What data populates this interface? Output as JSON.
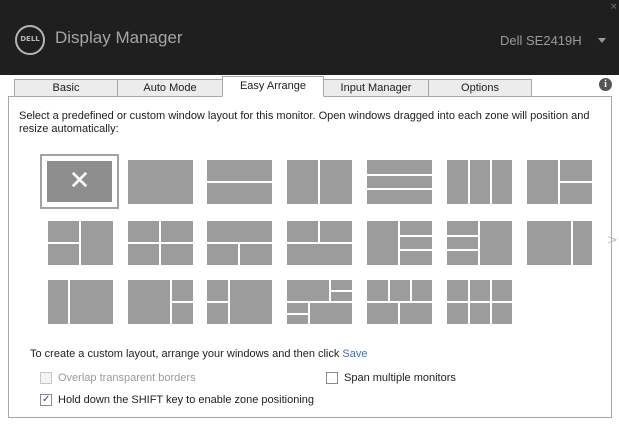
{
  "header": {
    "logo_text": "DELL",
    "app_title": "Display Manager",
    "monitor_name": "Dell SE2419H",
    "close_glyph": "×"
  },
  "tabs": [
    {
      "label": "Basic",
      "active": false
    },
    {
      "label": "Auto Mode",
      "active": false
    },
    {
      "label": "Easy Arrange",
      "active": true
    },
    {
      "label": "Input Manager",
      "active": false
    },
    {
      "label": "Options",
      "active": false
    }
  ],
  "info_icon": "i",
  "easy_arrange": {
    "description": "Select a predefined or custom window layout for this monitor.  Open windows dragged into each zone will position and resize automatically:",
    "clear_layout_glyph": "✕",
    "next_page_glyph": ">",
    "instruction": "To create a custom layout, arrange your windows and then click",
    "save_label": "Save",
    "options": [
      {
        "label": "Overlap transparent borders",
        "checked": false,
        "enabled": false
      },
      {
        "label": "Span multiple monitors",
        "checked": false,
        "enabled": true
      },
      {
        "label": "Hold down the SHIFT key to enable zone positioning",
        "checked": true,
        "enabled": true
      }
    ]
  },
  "colors": {
    "header_bg": "#1f1f1f",
    "tile": "#9c9c9c",
    "link": "#3c6fc4"
  }
}
